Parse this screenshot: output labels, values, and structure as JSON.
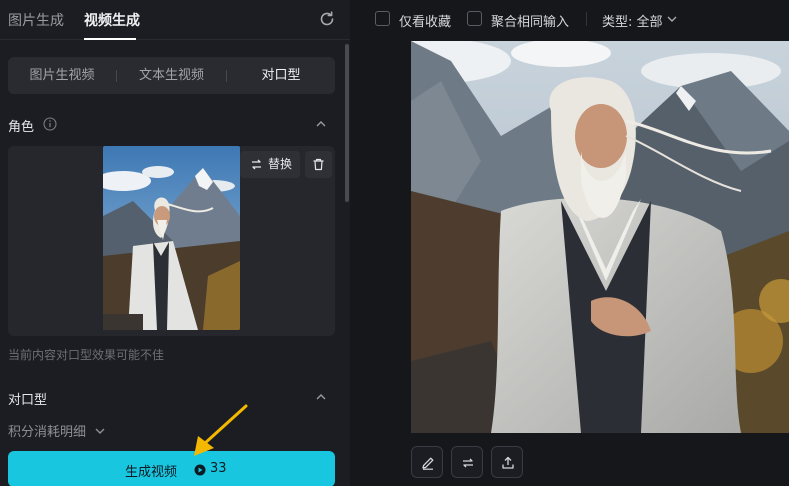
{
  "tabs": [
    {
      "label": "图片生成"
    },
    {
      "label": "视频生成"
    }
  ],
  "modes": [
    {
      "label": "图片生视频"
    },
    {
      "label": "文本生视频"
    },
    {
      "label": "对口型"
    }
  ],
  "role_section": {
    "title": "角色"
  },
  "role_card": {
    "replace_label": "替换"
  },
  "warning_text": "当前内容对口型效果可能不佳",
  "lipsync_section": {
    "title": "对口型"
  },
  "points_detail_label": "积分消耗明细",
  "generate_button": {
    "label": "生成视频",
    "cost": "33"
  },
  "filters": {
    "only_favorites": "仅看收藏",
    "merge_same_input": "聚合相同输入",
    "type_label": "类型: 全部"
  },
  "colors": {
    "accent": "#19c6e0",
    "arrow": "#f5b800"
  }
}
